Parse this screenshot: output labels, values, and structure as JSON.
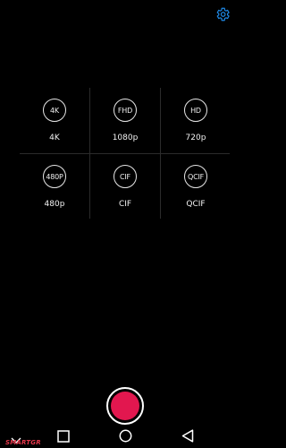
{
  "header": {
    "settings_icon": "gear-icon",
    "accent_color": "#1e88e5"
  },
  "resolutions": [
    {
      "badge": "4K",
      "label": "4K"
    },
    {
      "badge": "FHD",
      "label": "1080p"
    },
    {
      "badge": "HD",
      "label": "720p"
    },
    {
      "badge": "480P",
      "label": "480p"
    },
    {
      "badge": "CIF",
      "label": "CIF"
    },
    {
      "badge": "QCIF",
      "label": "QCIF"
    }
  ],
  "controls": {
    "collapse_icon": "chevron-down-icon",
    "record_color": "#e2174f",
    "watermark": "SMARTGR"
  },
  "navbar": {
    "recents_icon": "square-icon",
    "home_icon": "circle-icon",
    "back_icon": "triangle-back-icon"
  }
}
